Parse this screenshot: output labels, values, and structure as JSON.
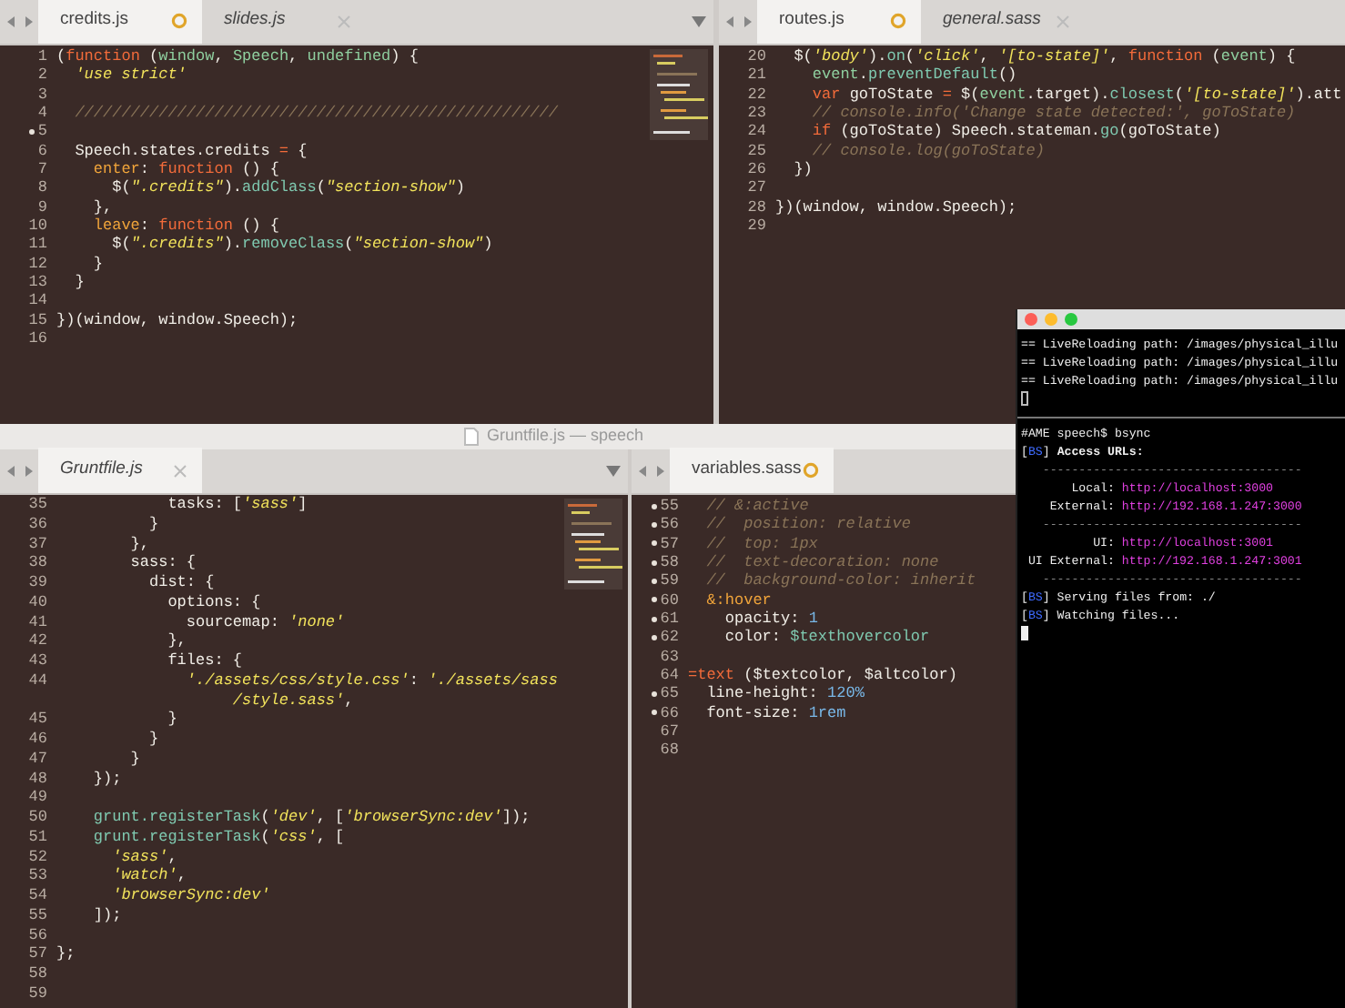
{
  "top_window": {
    "panes": [
      {
        "tabs": [
          {
            "label": "credits.js",
            "selected": true,
            "preview": false,
            "unsaved": true
          },
          {
            "label": "slides.js",
            "selected": false,
            "preview": true,
            "unsaved": false
          }
        ],
        "lines": [
          {
            "number": "1",
            "modified": false,
            "tokens": [
              {
                "kind": "plain",
                "text": "("
              },
              {
                "kind": "keyword",
                "text": "function"
              },
              {
                "kind": "plain",
                "text": " ("
              },
              {
                "kind": "param",
                "text": "window"
              },
              {
                "kind": "plain",
                "text": ", "
              },
              {
                "kind": "param",
                "text": "Speech"
              },
              {
                "kind": "plain",
                "text": ", "
              },
              {
                "kind": "param",
                "text": "undefined"
              },
              {
                "kind": "plain",
                "text": ") {"
              }
            ]
          },
          {
            "number": "2",
            "modified": false,
            "tokens": [
              {
                "kind": "string",
                "text": "  'use strict'"
              }
            ]
          },
          {
            "number": "3",
            "modified": false
          },
          {
            "number": "4",
            "modified": false,
            "tokens": [
              {
                "kind": "comment",
                "text": "  ////////////////////////////////////////////////////"
              }
            ]
          },
          {
            "number": "5",
            "modified": true
          },
          {
            "number": "6",
            "modified": false,
            "tokens": [
              {
                "kind": "plain",
                "text": "  Speech.states.credits "
              },
              {
                "kind": "keyword",
                "text": "="
              },
              {
                "kind": "plain",
                "text": " {"
              }
            ]
          },
          {
            "number": "7",
            "modified": false,
            "tokens": [
              {
                "kind": "prop",
                "text": "    enter"
              },
              {
                "kind": "plain",
                "text": ": "
              },
              {
                "kind": "keyword",
                "text": "function"
              },
              {
                "kind": "plain",
                "text": " () {"
              }
            ]
          },
          {
            "number": "8",
            "modified": false,
            "tokens": [
              {
                "kind": "plain",
                "text": "      $("
              },
              {
                "kind": "string",
                "text": "\".credits\""
              },
              {
                "kind": "plain",
                "text": ")."
              },
              {
                "kind": "func",
                "text": "addClass"
              },
              {
                "kind": "plain",
                "text": "("
              },
              {
                "kind": "string",
                "text": "\"section-show\""
              },
              {
                "kind": "plain",
                "text": ")"
              }
            ]
          },
          {
            "number": "9",
            "modified": false,
            "text": "    },"
          },
          {
            "number": "10",
            "modified": false,
            "tokens": [
              {
                "kind": "prop",
                "text": "    leave"
              },
              {
                "kind": "plain",
                "text": ": "
              },
              {
                "kind": "keyword",
                "text": "function"
              },
              {
                "kind": "plain",
                "text": " () {"
              }
            ]
          },
          {
            "number": "11",
            "modified": false,
            "tokens": [
              {
                "kind": "plain",
                "text": "      $("
              },
              {
                "kind": "string",
                "text": "\".credits\""
              },
              {
                "kind": "plain",
                "text": ")."
              },
              {
                "kind": "func",
                "text": "removeClass"
              },
              {
                "kind": "plain",
                "text": "("
              },
              {
                "kind": "string",
                "text": "\"section-show\""
              },
              {
                "kind": "plain",
                "text": ")"
              }
            ]
          },
          {
            "number": "12",
            "modified": false,
            "text": "    }"
          },
          {
            "number": "13",
            "modified": false,
            "text": "  }"
          },
          {
            "number": "14",
            "modified": false
          },
          {
            "number": "15",
            "modified": false,
            "text": "})(window, window.Speech);"
          },
          {
            "number": "16",
            "modified": false
          }
        ]
      },
      {
        "tabs": [
          {
            "label": "routes.js",
            "selected": true,
            "preview": false,
            "unsaved": true
          },
          {
            "label": "general.sass",
            "selected": false,
            "preview": true,
            "unsaved": false
          }
        ],
        "lines": [
          {
            "number": "20",
            "tokens": [
              {
                "kind": "plain",
                "text": "  $("
              },
              {
                "kind": "string",
                "text": "'body'"
              },
              {
                "kind": "plain",
                "text": ")."
              },
              {
                "kind": "func",
                "text": "on"
              },
              {
                "kind": "plain",
                "text": "("
              },
              {
                "kind": "string",
                "text": "'click'"
              },
              {
                "kind": "plain",
                "text": ", "
              },
              {
                "kind": "string",
                "text": "'[to-state]'"
              },
              {
                "kind": "plain",
                "text": ", "
              },
              {
                "kind": "keyword",
                "text": "function"
              },
              {
                "kind": "plain",
                "text": " ("
              },
              {
                "kind": "param",
                "text": "event"
              },
              {
                "kind": "plain",
                "text": ") {"
              }
            ]
          },
          {
            "number": "21",
            "tokens": [
              {
                "kind": "param",
                "text": "    event"
              },
              {
                "kind": "plain",
                "text": "."
              },
              {
                "kind": "func",
                "text": "preventDefault"
              },
              {
                "kind": "plain",
                "text": "()"
              }
            ]
          },
          {
            "number": "22",
            "tokens": [
              {
                "kind": "keyword",
                "text": "    var"
              },
              {
                "kind": "plain",
                "text": " goToState "
              },
              {
                "kind": "keyword",
                "text": "="
              },
              {
                "kind": "plain",
                "text": " $("
              },
              {
                "kind": "param",
                "text": "event"
              },
              {
                "kind": "plain",
                "text": ".target)."
              },
              {
                "kind": "func",
                "text": "closest"
              },
              {
                "kind": "plain",
                "text": "("
              },
              {
                "kind": "string",
                "text": "'[to-state]'"
              },
              {
                "kind": "plain",
                "text": ").att"
              }
            ]
          },
          {
            "number": "23",
            "tokens": [
              {
                "kind": "comment",
                "text": "    // console.info('Change state detected:', goToState)"
              }
            ]
          },
          {
            "number": "24",
            "tokens": [
              {
                "kind": "keyword",
                "text": "    if"
              },
              {
                "kind": "plain",
                "text": " (goToState) Speech.stateman."
              },
              {
                "kind": "func",
                "text": "go"
              },
              {
                "kind": "plain",
                "text": "(goToState)"
              }
            ]
          },
          {
            "number": "25",
            "tokens": [
              {
                "kind": "comment",
                "text": "    // console.log(goToState)"
              }
            ]
          },
          {
            "number": "26",
            "text": "  })"
          },
          {
            "number": "27"
          },
          {
            "number": "28",
            "text": "})(window, window.Speech);"
          },
          {
            "number": "29"
          }
        ]
      }
    ]
  },
  "bottom_window": {
    "title": "Gruntfile.js — speech",
    "panes": [
      {
        "tabs": [
          {
            "label": "Gruntfile.js",
            "selected": true,
            "preview": true,
            "unsaved": false
          }
        ],
        "lines": [
          {
            "number": "35",
            "tokens": [
              {
                "kind": "plain",
                "text": "            tasks: ["
              },
              {
                "kind": "string",
                "text": "'sass'"
              },
              {
                "kind": "plain",
                "text": "]"
              }
            ]
          },
          {
            "number": "36",
            "text": "          }"
          },
          {
            "number": "37",
            "text": "        },"
          },
          {
            "number": "38",
            "text": "        sass: {"
          },
          {
            "number": "39",
            "text": "          dist: {"
          },
          {
            "number": "40",
            "text": "            options: {"
          },
          {
            "number": "41",
            "tokens": [
              {
                "kind": "plain",
                "text": "              sourcemap: "
              },
              {
                "kind": "string",
                "text": "'none'"
              }
            ]
          },
          {
            "number": "42",
            "text": "            },"
          },
          {
            "number": "43",
            "text": "            files: {"
          },
          {
            "number": "44",
            "tokens": [
              {
                "kind": "string",
                "text": "              './assets/css/style.css'"
              },
              {
                "kind": "plain",
                "text": ": "
              },
              {
                "kind": "string",
                "text": "'./assets/sass"
              }
            ]
          },
          {
            "tokens": [
              {
                "kind": "string",
                "text": "                   /style.sass'"
              },
              {
                "kind": "plain",
                "text": ","
              }
            ]
          },
          {
            "number": "45",
            "text": "            }"
          },
          {
            "number": "46",
            "text": "          }"
          },
          {
            "number": "47",
            "text": "        }"
          },
          {
            "number": "48",
            "text": "    });"
          },
          {
            "number": "49"
          },
          {
            "number": "50",
            "tokens": [
              {
                "kind": "func",
                "text": "    grunt.registerTask"
              },
              {
                "kind": "plain",
                "text": "("
              },
              {
                "kind": "string",
                "text": "'dev'"
              },
              {
                "kind": "plain",
                "text": ", ["
              },
              {
                "kind": "string",
                "text": "'browserSync:dev'"
              },
              {
                "kind": "plain",
                "text": "]);"
              }
            ]
          },
          {
            "number": "51",
            "tokens": [
              {
                "kind": "func",
                "text": "    grunt.registerTask"
              },
              {
                "kind": "plain",
                "text": "("
              },
              {
                "kind": "string",
                "text": "'css'"
              },
              {
                "kind": "plain",
                "text": ", ["
              }
            ]
          },
          {
            "number": "52",
            "tokens": [
              {
                "kind": "string",
                "text": "      'sass'"
              },
              {
                "kind": "plain",
                "text": ","
              }
            ]
          },
          {
            "number": "53",
            "tokens": [
              {
                "kind": "string",
                "text": "      'watch'"
              },
              {
                "kind": "plain",
                "text": ","
              }
            ]
          },
          {
            "number": "54",
            "tokens": [
              {
                "kind": "string",
                "text": "      'browserSync:dev'"
              }
            ]
          },
          {
            "number": "55",
            "text": "    ]);"
          },
          {
            "number": "56"
          },
          {
            "number": "57",
            "text": "};"
          },
          {
            "number": "58"
          },
          {
            "number": "59"
          }
        ]
      },
      {
        "tabs": [
          {
            "label": "variables.sass",
            "selected": true,
            "preview": false,
            "unsaved": true
          }
        ],
        "lines": [
          {
            "number": "55",
            "modified": true,
            "tokens": [
              {
                "kind": "comment",
                "text": "  // &:active"
              }
            ]
          },
          {
            "number": "56",
            "modified": true,
            "tokens": [
              {
                "kind": "comment",
                "text": "  //  position: relative"
              }
            ]
          },
          {
            "number": "57",
            "modified": true,
            "tokens": [
              {
                "kind": "comment",
                "text": "  //  top: 1px"
              }
            ]
          },
          {
            "number": "58",
            "modified": true,
            "tokens": [
              {
                "kind": "comment",
                "text": "  //  text-decoration: none"
              }
            ]
          },
          {
            "number": "59",
            "modified": true,
            "tokens": [
              {
                "kind": "comment",
                "text": "  //  background-color: inherit"
              }
            ]
          },
          {
            "number": "60",
            "modified": true,
            "tokens": [
              {
                "kind": "prop",
                "text": "  &:hover"
              }
            ]
          },
          {
            "number": "61",
            "modified": true,
            "tokens": [
              {
                "kind": "plain",
                "text": "    opacity: "
              },
              {
                "kind": "number",
                "text": "1"
              }
            ]
          },
          {
            "number": "62",
            "modified": true,
            "tokens": [
              {
                "kind": "plain",
                "text": "    color: "
              },
              {
                "kind": "var",
                "text": "$texthovercolor"
              }
            ]
          },
          {
            "number": "63",
            "modified": false
          },
          {
            "number": "64",
            "modified": false,
            "tokens": [
              {
                "kind": "keyword",
                "text": "=text"
              },
              {
                "kind": "plain",
                "text": " ($textcolor, $altcolor)"
              }
            ]
          },
          {
            "number": "65",
            "modified": true,
            "tokens": [
              {
                "kind": "plain",
                "text": "  line-height: "
              },
              {
                "kind": "number",
                "text": "120%"
              }
            ]
          },
          {
            "number": "66",
            "modified": true,
            "tokens": [
              {
                "kind": "plain",
                "text": "  font-size: "
              },
              {
                "kind": "number",
                "text": "1rem"
              }
            ]
          },
          {
            "number": "67",
            "modified": false
          },
          {
            "number": "68",
            "modified": false
          }
        ]
      }
    ]
  },
  "terminal": {
    "panes": [
      {
        "focused": false,
        "lines": [
          {
            "text": "== LiveReloading path: /images/physical_illu"
          },
          {
            "text": "== LiveReloading path: /images/physical_illu"
          },
          {
            "text": "== LiveReloading path: /images/physical_illu"
          }
        ]
      },
      {
        "focused": true,
        "lines": [
          {
            "text": "#AME speech$ bsync"
          },
          {
            "tokens": [
              {
                "kind": "plain",
                "text": "["
              },
              {
                "kind": "tag",
                "text": "BS"
              },
              {
                "kind": "plain",
                "text": "] "
              },
              {
                "kind": "bold",
                "text": "Access URLs:"
              }
            ]
          },
          {
            "tokens": [
              {
                "kind": "rule",
                "text": "   ------------------------------------"
              }
            ]
          },
          {
            "tokens": [
              {
                "kind": "plain",
                "text": "       Local: "
              },
              {
                "kind": "url",
                "text": "http://localhost:3000"
              }
            ]
          },
          {
            "tokens": [
              {
                "kind": "plain",
                "text": "    External: "
              },
              {
                "kind": "url",
                "text": "http://192.168.1.247:3000"
              }
            ]
          },
          {
            "tokens": [
              {
                "kind": "rule",
                "text": "   ------------------------------------"
              }
            ]
          },
          {
            "tokens": [
              {
                "kind": "plain",
                "text": "          UI: "
              },
              {
                "kind": "url",
                "text": "http://localhost:3001"
              }
            ]
          },
          {
            "tokens": [
              {
                "kind": "plain",
                "text": " UI External: "
              },
              {
                "kind": "url",
                "text": "http://192.168.1.247:3001"
              }
            ]
          },
          {
            "tokens": [
              {
                "kind": "rule",
                "text": "   ------------------------------------"
              }
            ]
          },
          {
            "tokens": [
              {
                "kind": "plain",
                "text": "["
              },
              {
                "kind": "tag",
                "text": "BS"
              },
              {
                "kind": "plain",
                "text": "] Serving files from: ./"
              }
            ]
          },
          {
            "tokens": [
              {
                "kind": "plain",
                "text": "["
              },
              {
                "kind": "tag",
                "text": "BS"
              },
              {
                "kind": "plain",
                "text": "] Watching files..."
              }
            ]
          }
        ]
      }
    ]
  }
}
